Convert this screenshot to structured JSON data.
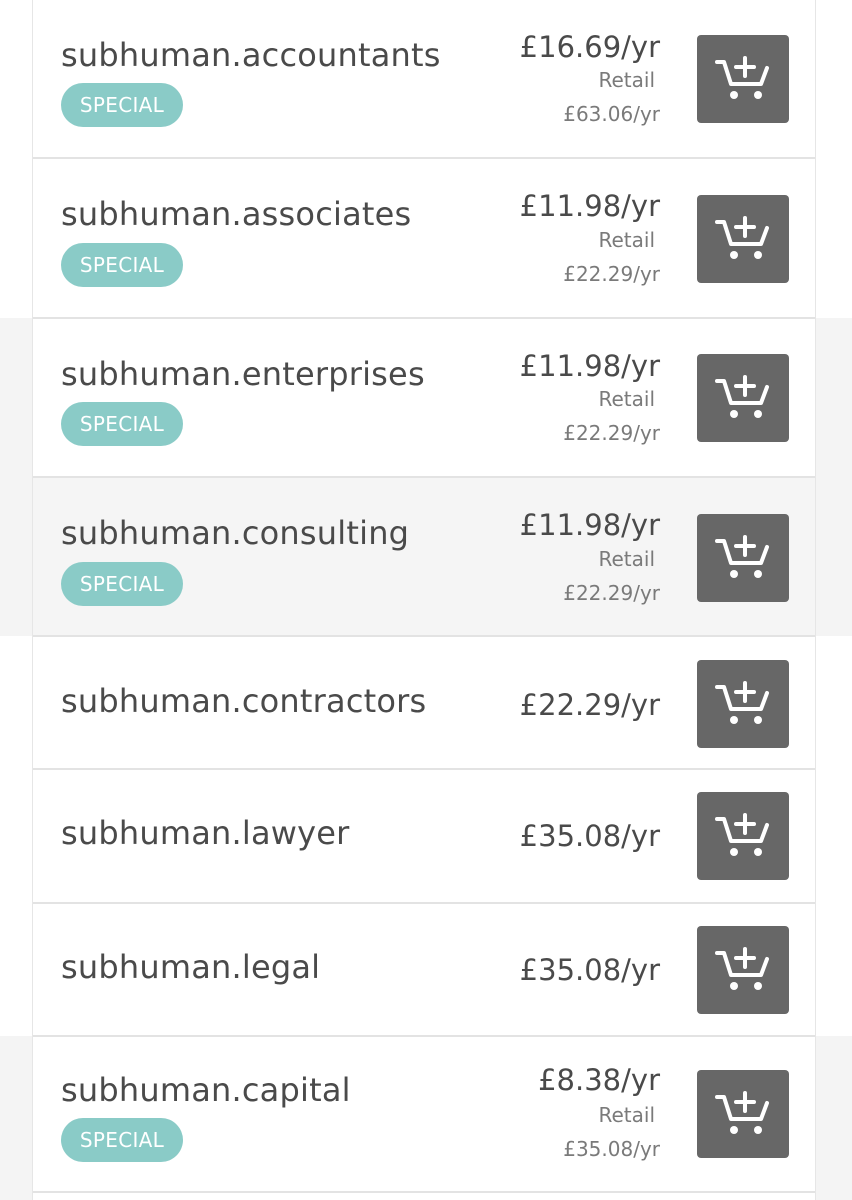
{
  "colors": {
    "badge_bg": "#8acbc7",
    "cart_button_bg": "#676767",
    "text_primary": "#4a4a4a",
    "text_secondary": "#7a7a7a"
  },
  "domains": [
    {
      "name": "subhuman.accountants",
      "badge": "SPECIAL",
      "price": "£16.69/yr",
      "retail_label": "Retail",
      "retail_price": "£63.06/yr",
      "cart_icon": "add-to-cart-icon"
    },
    {
      "name": "subhuman.associates",
      "badge": "SPECIAL",
      "price": "£11.98/yr",
      "retail_label": "Retail",
      "retail_price": "£22.29/yr",
      "cart_icon": "add-to-cart-icon"
    },
    {
      "name": "subhuman.enterprises",
      "badge": "SPECIAL",
      "price": "£11.98/yr",
      "retail_label": "Retail",
      "retail_price": "£22.29/yr",
      "cart_icon": "add-to-cart-icon"
    },
    {
      "name": "subhuman.consulting",
      "badge": "SPECIAL",
      "price": "£11.98/yr",
      "retail_label": "Retail",
      "retail_price": "£22.29/yr",
      "cart_icon": "add-to-cart-icon"
    },
    {
      "name": "subhuman.contractors",
      "price": "£22.29/yr",
      "cart_icon": "add-to-cart-icon"
    },
    {
      "name": "subhuman.lawyer",
      "price": "£35.08/yr",
      "cart_icon": "add-to-cart-icon"
    },
    {
      "name": "subhuman.legal",
      "price": "£35.08/yr",
      "cart_icon": "add-to-cart-icon"
    },
    {
      "name": "subhuman.capital",
      "badge": "SPECIAL",
      "price": "£8.38/yr",
      "retail_label": "Retail",
      "retail_price": "£35.08/yr",
      "cart_icon": "add-to-cart-icon"
    }
  ]
}
